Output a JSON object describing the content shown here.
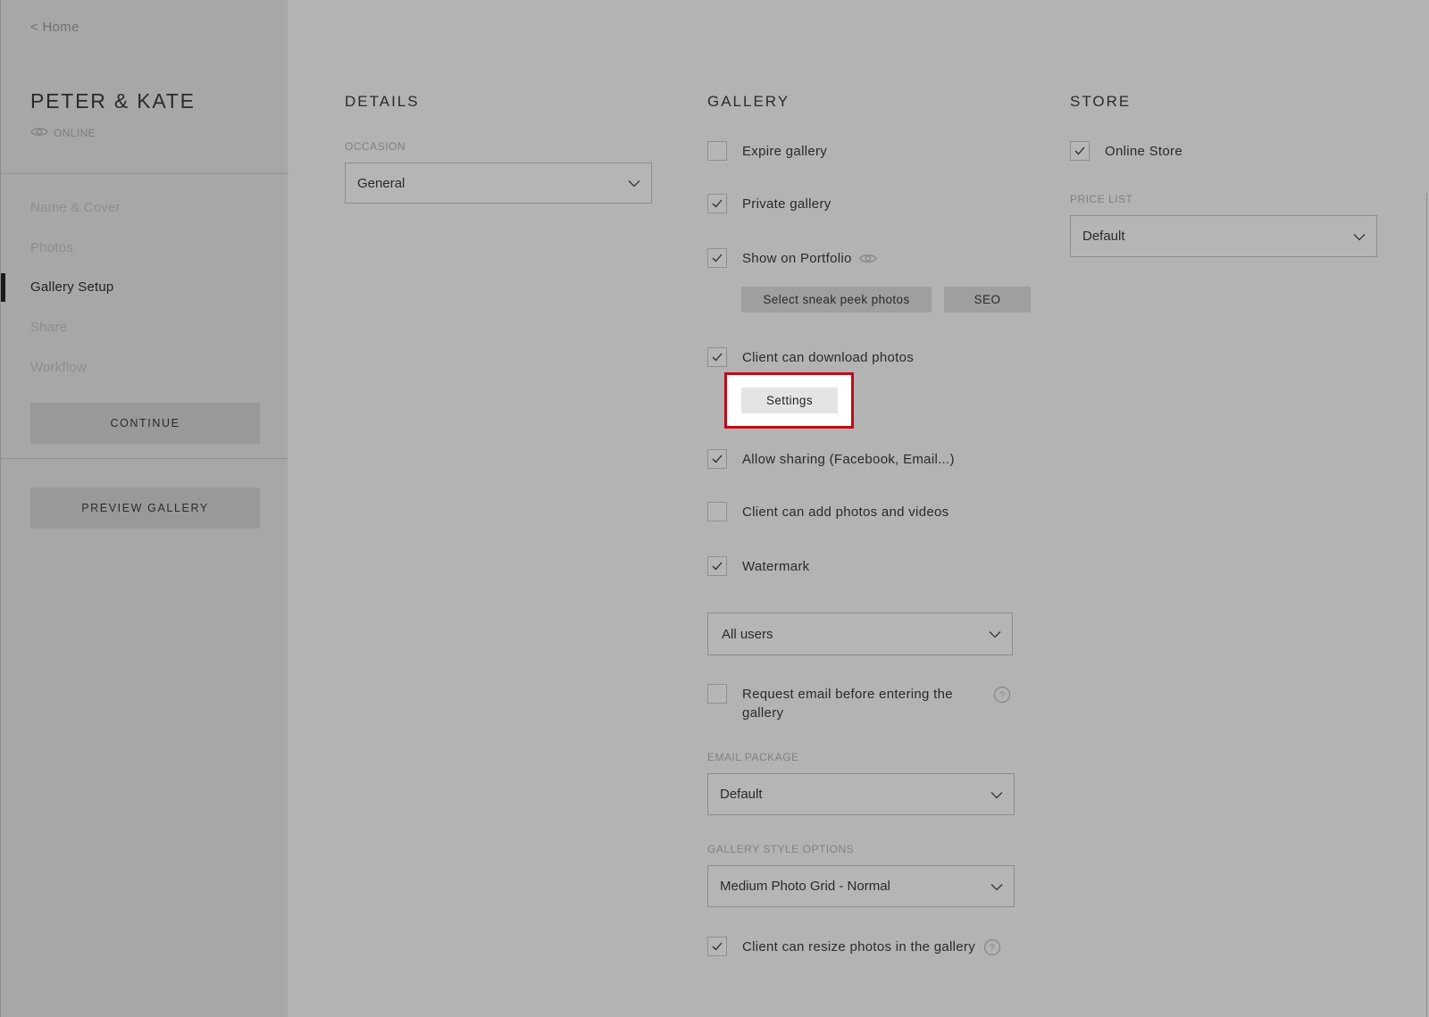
{
  "sidebar": {
    "back_link": "< Home",
    "title": "PETER & KATE",
    "status": "ONLINE",
    "nav": [
      "Name & Cover",
      "Photos",
      "Gallery Setup",
      "Share",
      "Workflow"
    ],
    "active_nav": "Gallery Setup",
    "continue_label": "CONTINUE",
    "preview_label": "PREVIEW GALLERY"
  },
  "details": {
    "header": "DETAILS",
    "occasion_label": "OCCASION",
    "occasion_value": "General"
  },
  "gallery": {
    "header": "GALLERY",
    "expire": {
      "label": "Expire gallery",
      "checked": false
    },
    "private": {
      "label": "Private gallery",
      "checked": true
    },
    "portfolio": {
      "label": "Show on Portfolio",
      "checked": true
    },
    "sneak_peek_label": "Select sneak peek photos",
    "seo_label": "SEO",
    "download": {
      "label": "Client can download photos",
      "checked": true
    },
    "settings_label": "Settings",
    "sharing": {
      "label": "Allow sharing (Facebook, Email...)",
      "checked": true
    },
    "add_photos": {
      "label": "Client can add photos and videos",
      "checked": false
    },
    "watermark": {
      "label": "Watermark",
      "checked": true
    },
    "watermark_scope": "All users",
    "request_email": {
      "label": "Request email before entering the gallery",
      "checked": false
    },
    "email_package_label": "EMAIL PACKAGE",
    "email_package_value": "Default",
    "style_label": "GALLERY STYLE OPTIONS",
    "style_value": "Medium Photo Grid - Normal",
    "resize": {
      "label": "Client can resize photos in the gallery",
      "checked": true
    }
  },
  "store": {
    "header": "STORE",
    "online_store": {
      "label": "Online Store",
      "checked": true
    },
    "price_list_label": "PRICE LIST",
    "price_list_value": "Default"
  },
  "colors": {
    "highlight": "#c00a18",
    "background": "#b3b3b3",
    "sidebar": "#a7a7a7"
  }
}
